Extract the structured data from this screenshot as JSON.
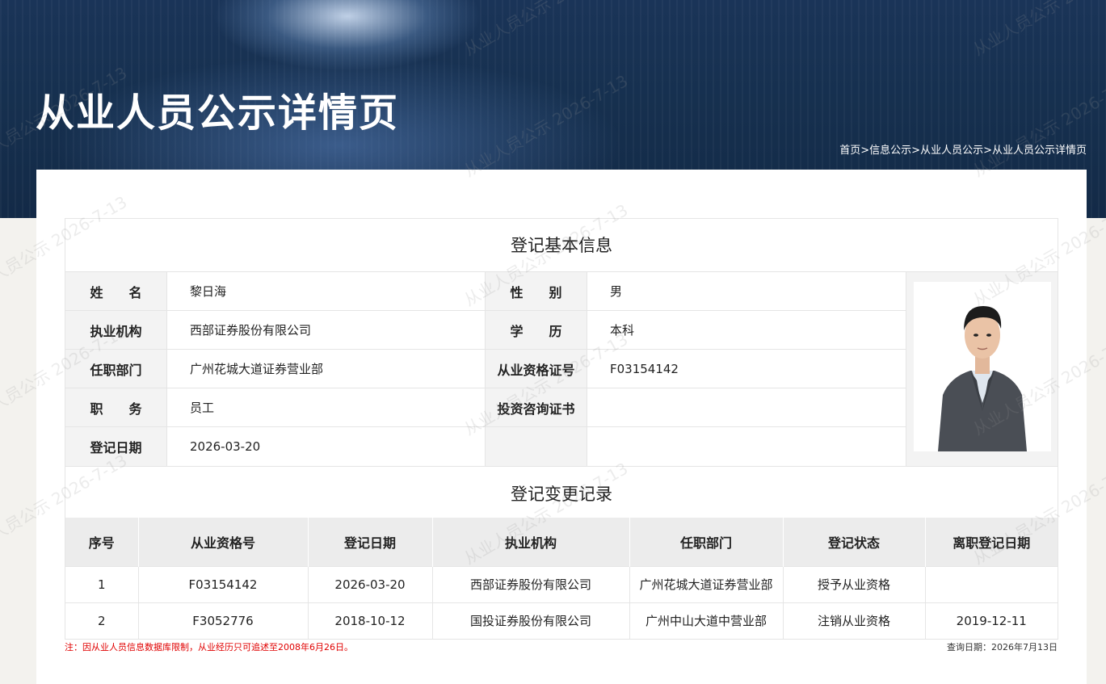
{
  "header": {
    "title": "从业人员公示详情页",
    "breadcrumb": [
      "首页",
      "信息公示",
      "从业人员公示",
      "从业人员公示详情页"
    ],
    "separator": ">"
  },
  "watermark": {
    "text": "从业人员公示 2026-7-13"
  },
  "basic_info": {
    "title": "登记基本信息",
    "rows": [
      {
        "label_left": "姓　　名",
        "value_left": "黎日海",
        "label_right": "性　　别",
        "value_right": "男"
      },
      {
        "label_left": "执业机构",
        "value_left": "西部证券股份有限公司",
        "label_right": "学　　历",
        "value_right": "本科"
      },
      {
        "label_left": "任职部门",
        "value_left": "广州花城大道证券营业部",
        "label_right": "从业资格证号",
        "value_right": "F03154142"
      },
      {
        "label_left": "职　　务",
        "value_left": "员工",
        "label_right": "投资咨询证书",
        "value_right": ""
      },
      {
        "label_left": "登记日期",
        "value_left": "2026-03-20",
        "label_right": "",
        "value_right": ""
      }
    ],
    "photo_icon": "person-photo-icon"
  },
  "change_records": {
    "title": "登记变更记录",
    "headers": [
      "序号",
      "从业资格号",
      "登记日期",
      "执业机构",
      "任职部门",
      "登记状态",
      "离职登记日期"
    ],
    "rows": [
      [
        "1",
        "F03154142",
        "2026-03-20",
        "西部证券股份有限公司",
        "广州花城大道证券营业部",
        "授予从业资格",
        ""
      ],
      [
        "2",
        "F3052776",
        "2018-10-12",
        "国投证券股份有限公司",
        "广州中山大道中营业部",
        "注销从业资格",
        "2019-12-11"
      ]
    ]
  },
  "footer": {
    "note": "注：因从业人员信息数据库限制，从业经历只可追述至2008年6月26日。",
    "query_date": "查询日期：2026年7月13日"
  },
  "colors": {
    "banner": "#16304f",
    "label_bg": "#f3f3f3",
    "note_red": "#e00000"
  }
}
